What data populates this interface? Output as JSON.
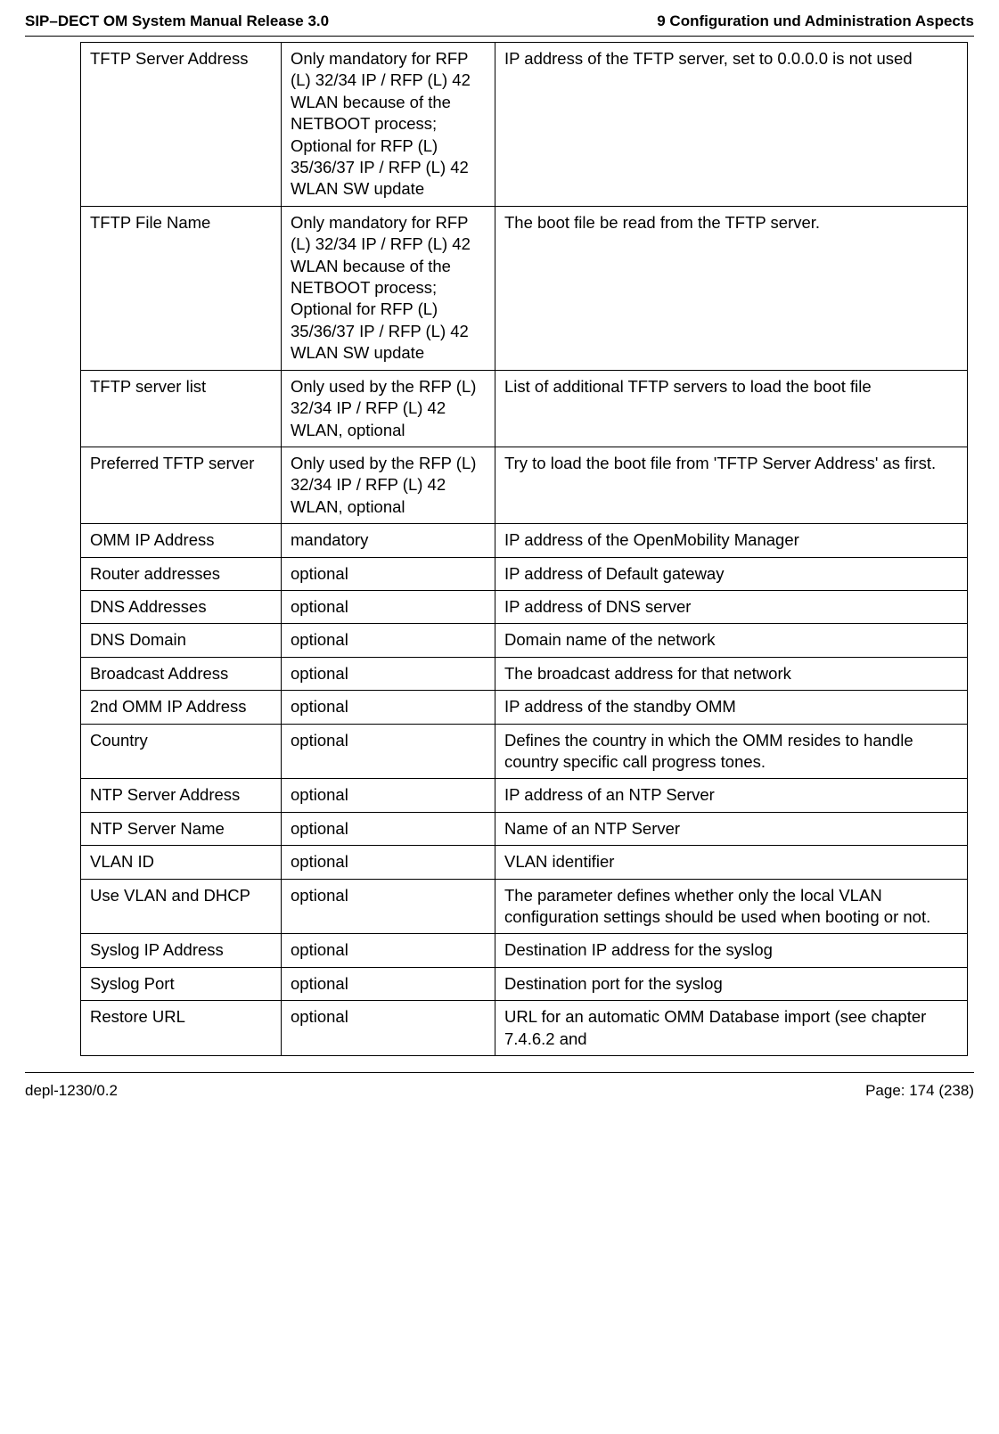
{
  "header": {
    "left": "SIP–DECT OM System Manual Release 3.0",
    "right": "9 Configuration und Administration Aspects"
  },
  "footer": {
    "left": "depl-1230/0.2",
    "right": "Page: 174 (238)"
  },
  "rows": [
    {
      "c1": "TFTP Server Address",
      "c2": "Only mandatory for RFP (L) 32/34 IP / RFP (L) 42 WLAN because of the NETBOOT process;\nOptional for RFP (L) 35/36/37 IP / RFP (L) 42 WLAN SW update",
      "c3": "IP address of the TFTP server, set to 0.0.0.0 is not used"
    },
    {
      "c1": "TFTP File Name",
      "c2": "Only mandatory for RFP (L) 32/34 IP / RFP (L) 42 WLAN because of the NETBOOT process;\nOptional for RFP (L) 35/36/37 IP / RFP (L) 42 WLAN SW update",
      "c3": "The boot file be read from the TFTP server."
    },
    {
      "c1": "TFTP server list",
      "c2": "Only used by the RFP (L) 32/34 IP / RFP (L) 42 WLAN, optional",
      "c3": "List of additional TFTP servers to load the boot file"
    },
    {
      "c1": "Preferred TFTP server",
      "c2": "Only used by the RFP (L) 32/34 IP / RFP (L) 42 WLAN, optional",
      "c3": "Try to load the boot file from 'TFTP Server Address' as first."
    },
    {
      "c1": "OMM IP Address",
      "c2": "mandatory",
      "c3": "IP address of the OpenMobility Manager"
    },
    {
      "c1": "Router addresses",
      "c2": "optional",
      "c3": "IP address of Default gateway"
    },
    {
      "c1": "DNS Addresses",
      "c2": "optional",
      "c3": "IP address of DNS server"
    },
    {
      "c1": "DNS Domain",
      "c2": "optional",
      "c3": "Domain name of the network"
    },
    {
      "c1": "Broadcast Address",
      "c2": "optional",
      "c3": "The broadcast address for that network"
    },
    {
      "c1": "2nd OMM IP Address",
      "c2": "optional",
      "c3": "IP address of the standby OMM"
    },
    {
      "c1": "Country",
      "c2": "optional",
      "c3": "Defines the country in which the OMM resides to handle country specific call progress tones."
    },
    {
      "c1": "NTP Server Address",
      "c2": "optional",
      "c3": "IP address of an NTP Server"
    },
    {
      "c1": "NTP Server Name",
      "c2": "optional",
      "c3": "Name of an NTP Server"
    },
    {
      "c1": "VLAN ID",
      "c2": "optional",
      "c3": "VLAN identifier"
    },
    {
      "c1": "Use VLAN and DHCP",
      "c2": "optional",
      "c3": "The parameter defines whether only the local VLAN configuration settings should be used when booting or not."
    },
    {
      "c1": "Syslog IP Address",
      "c2": "optional",
      "c3": "Destination IP address for the syslog"
    },
    {
      "c1": "Syslog Port",
      "c2": "optional",
      "c3": "Destination port for the syslog"
    },
    {
      "c1": "Restore URL",
      "c2": "optional",
      "c3": "URL for an automatic OMM Database import (see chapter 7.4.6.2 and"
    }
  ]
}
